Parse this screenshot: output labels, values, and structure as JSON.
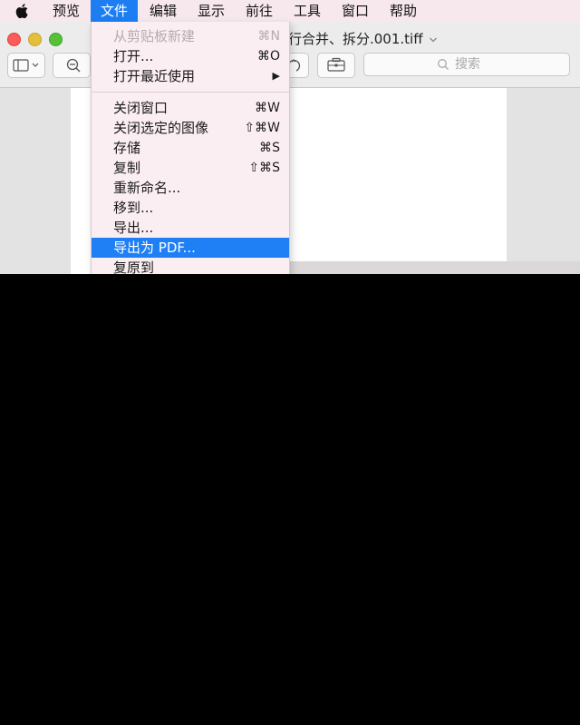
{
  "menubar": {
    "items": [
      {
        "label": "预览"
      },
      {
        "label": "文件"
      },
      {
        "label": "编辑"
      },
      {
        "label": "显示"
      },
      {
        "label": "前往"
      },
      {
        "label": "工具"
      },
      {
        "label": "窗口"
      },
      {
        "label": "帮助"
      }
    ],
    "active_index": 1
  },
  "window": {
    "title": "行合并、拆分.001.tiff",
    "search_placeholder": "搜索"
  },
  "file_menu": {
    "items": [
      {
        "label": "从剪贴板新建",
        "shortcut": "⌘N",
        "disabled": true
      },
      {
        "label": "打开...",
        "shortcut": "⌘O"
      },
      {
        "label": "打开最近使用",
        "shortcut": "▶"
      },
      {
        "label": "关闭窗口",
        "shortcut": "⌘W"
      },
      {
        "label": "关闭选定的图像",
        "shortcut": "⇧⌘W"
      },
      {
        "label": "存储",
        "shortcut": "⌘S"
      },
      {
        "label": "复制",
        "shortcut": "⇧⌘S"
      },
      {
        "label": "重新命名...",
        "shortcut": ""
      },
      {
        "label": "移到...",
        "shortcut": ""
      },
      {
        "label": "导出...",
        "shortcut": ""
      },
      {
        "label": "导出为 PDF...",
        "shortcut": "",
        "highlighted": true
      },
      {
        "label": "复原到",
        "shortcut": ""
      }
    ]
  },
  "colors": {
    "menu_highlight": "#1f7ff5",
    "close": "#fc5b57",
    "minimize": "#e5bf3c",
    "zoom": "#57c038"
  }
}
